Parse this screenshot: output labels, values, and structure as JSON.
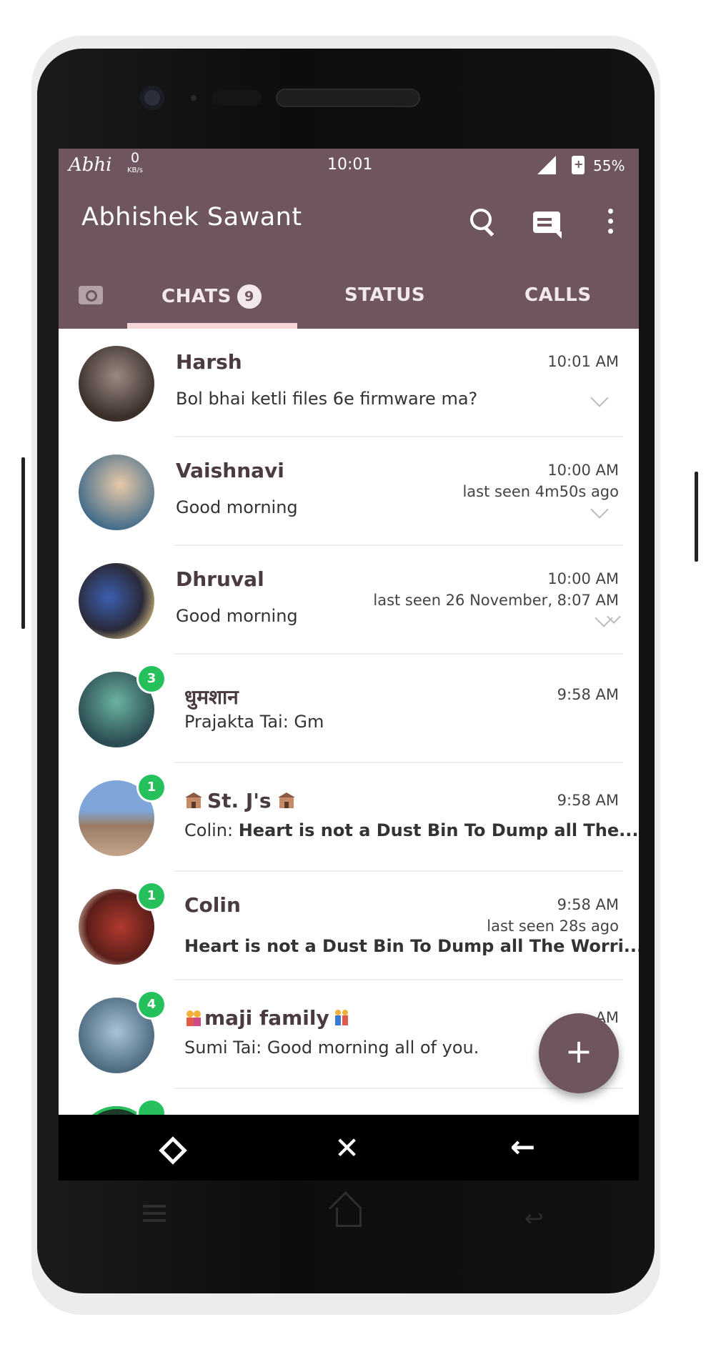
{
  "statusbar": {
    "carrier": "Abhi",
    "speed_value": "0",
    "speed_unit": "KB/s",
    "time": "10:01",
    "battery": "55%"
  },
  "appbar": {
    "title": "Abhishek Sawant",
    "icons": [
      "search-icon",
      "new-chat-icon",
      "more-vert-icon"
    ]
  },
  "tabs": {
    "chats_label": "CHATS",
    "chats_badge": "9",
    "status_label": "STATUS",
    "calls_label": "CALLS",
    "active": "CHATS"
  },
  "chats": [
    {
      "name": "Harsh",
      "time": "10:01 AM",
      "last_seen": "",
      "message": "Bol bhai ketli files 6e firmware ma?",
      "unread": ""
    },
    {
      "name": "Vaishnavi",
      "time": "10:00 AM",
      "last_seen": "last seen 4m50s ago",
      "message": "Good morning",
      "unread": ""
    },
    {
      "name": "Dhruval",
      "time": "10:00 AM",
      "last_seen": "last seen 26 November, 8:07 AM",
      "message": "Good morning",
      "unread": ""
    },
    {
      "name": "धुमशान",
      "time": "9:58 AM",
      "last_seen": "",
      "sender": "Prajakta Tai: ",
      "message": "Gm",
      "unread": "3"
    },
    {
      "name": "St. J's",
      "time": "9:58 AM",
      "last_seen": "",
      "sender": "Colin: ",
      "message": "Heart is not a Dust Bin To Dump all The...",
      "unread": "1"
    },
    {
      "name": "Colin",
      "time": "9:58 AM",
      "last_seen": "last seen 28s ago",
      "message": "Heart is not a Dust Bin To Dump all The Worri...",
      "unread": "1"
    },
    {
      "name": "maji family",
      "time": "AM",
      "last_seen": "",
      "sender": "Sumi Tai: ",
      "message": "Good morning all of you.",
      "unread": "4"
    }
  ],
  "fab": {
    "label": "+"
  },
  "colors": {
    "primary": "#6e5560",
    "unread_badge": "#25c05c"
  }
}
